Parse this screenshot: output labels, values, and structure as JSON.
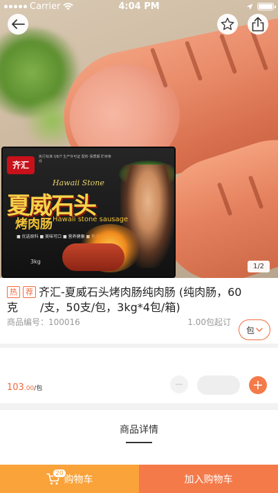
{
  "status_bar": {
    "carrier": "Carrier",
    "time": "4:04 PM"
  },
  "gallery": {
    "page_indicator": "1/2",
    "package": {
      "brand_logo": "齐汇",
      "fine_print": "执行标准 QB/T 生产许可证 配料 保质期 贮存条件",
      "brand_en": "Hawaii Stone",
      "name_cn": "夏威石头",
      "product_cn": "烤肉肠",
      "product_en": "Hawaii stone sausage",
      "features": "■ 优选原料  ■ 美味可口  ■ 营养健康  ■ 色泽鲜亮",
      "weight": "3kg"
    }
  },
  "product": {
    "tags": [
      "热",
      "荐"
    ],
    "title": "齐汇-夏威石头烤肉肠纯肉肠 (纯肉肠，60克　　/支，50支/包，3kg*4包/箱)",
    "sku_label": "商品编号：100016",
    "moq": "1.00包起订",
    "unit": "包",
    "price_main": "103",
    "price_cents": ".00",
    "price_unit": "/包",
    "quantity": ""
  },
  "detail": {
    "tab_label": "商品详情"
  },
  "bottom": {
    "cart_label": "购物车",
    "cart_count": "20",
    "add_to_cart_label": "加入购物车"
  },
  "colors": {
    "accent": "#f47a4a",
    "cart_button": "#f9a33a",
    "tag": "#f2693b"
  }
}
